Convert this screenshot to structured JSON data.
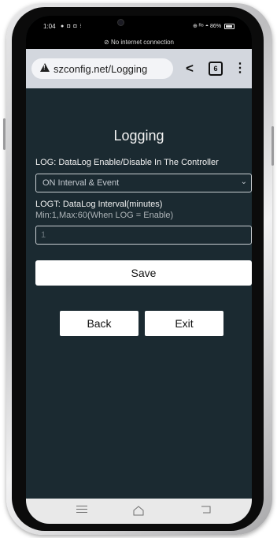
{
  "status_bar": {
    "time": "1:04",
    "left_icons": "● ◘ ◘ ⁝",
    "right_icons": "⊕ ᴿ⁸ ◓",
    "battery": "86%",
    "network_notice": "No internet connection"
  },
  "browser": {
    "url": "szconfig.net/Logging",
    "tab_count": "6"
  },
  "page": {
    "title": "Logging",
    "log_label": "LOG: DataLog Enable/Disable In The Controller",
    "log_select_value": "ON Interval & Event",
    "logt_label": "LOGT: DataLog Interval(minutes)",
    "logt_hint": "Min:1,Max:60(When LOG = Enable)",
    "logt_value": "1",
    "save_label": "Save",
    "back_label": "Back",
    "exit_label": "Exit"
  }
}
